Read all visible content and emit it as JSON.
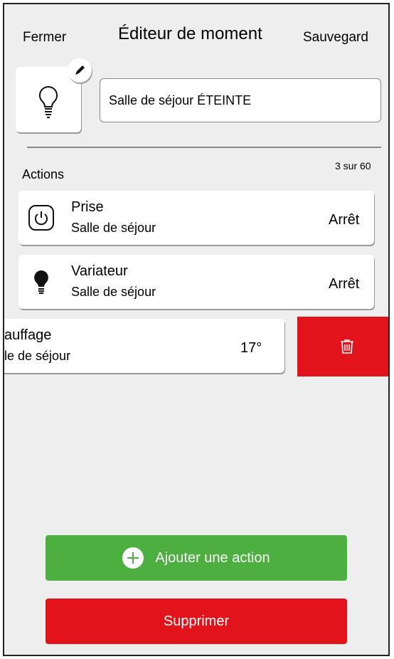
{
  "header": {
    "close_label": "Fermer",
    "title": "Éditeur de moment",
    "save_label": "Sauvegard"
  },
  "moment": {
    "icon": "lightbulb-icon",
    "name": "Salle de séjour ÉTEINTE"
  },
  "actions_section": {
    "label": "Actions",
    "count": "3 sur 60"
  },
  "actions": [
    {
      "icon": "power-icon",
      "title": "Prise",
      "subtitle": "Salle de séjour",
      "value": "Arrêt"
    },
    {
      "icon": "bulb-filled-icon",
      "title": "Variateur",
      "subtitle": "Salle de séjour",
      "value": "Arrêt"
    },
    {
      "title": "auffage",
      "subtitle": "le de séjour",
      "value": "17°"
    }
  ],
  "buttons": {
    "add_action": "Ajouter une action",
    "delete": "Supprimer"
  },
  "colors": {
    "add": "#4caf3f",
    "delete": "#e3131b",
    "background": "#eeeeee"
  }
}
